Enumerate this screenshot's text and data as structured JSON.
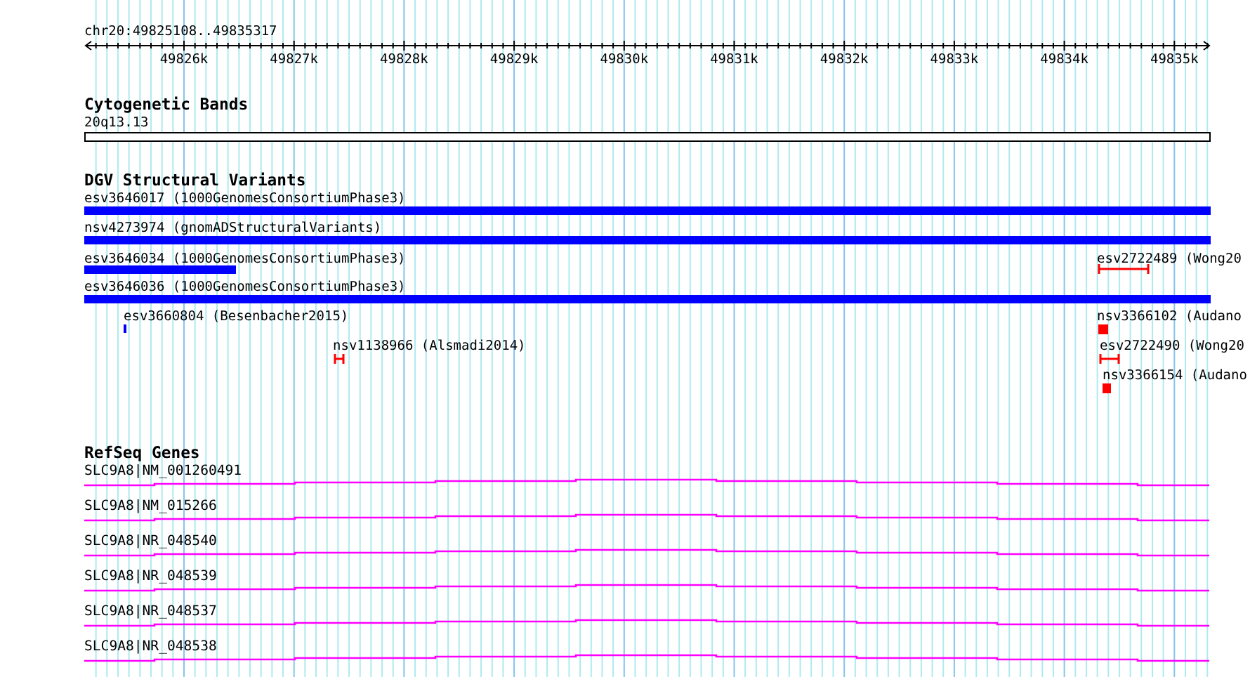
{
  "ruler": {
    "region": "chr20:49825108..49835317",
    "tick_labels": [
      "49826k",
      "49827k",
      "49828k",
      "49829k",
      "49830k",
      "49831k",
      "49832k",
      "49833k",
      "49834k",
      "49835k"
    ]
  },
  "tracks": [
    {
      "kind": "cytoband",
      "title": "Cytogenetic Bands",
      "features": [
        {
          "label": "20q13.13",
          "kind": "band"
        }
      ]
    },
    {
      "kind": "variants",
      "title": "DGV Structural Variants",
      "features": [
        {
          "label": "esv3646017 (1000GenomesConsortiumPhase3)",
          "kind": "bar",
          "color": "#0000ff"
        },
        {
          "label": "nsv4273974 (gnomADStructuralVariants)",
          "kind": "bar",
          "color": "#0000ff"
        },
        {
          "label": "esv3646034 (1000GenomesConsortiumPhase3)",
          "kind": "bar",
          "color": "#0000ff"
        },
        {
          "label": "esv2722489 (Wong20",
          "kind": "range",
          "color": "#ff0000"
        },
        {
          "label": "esv3646036 (1000GenomesConsortiumPhase3)",
          "kind": "bar",
          "color": "#0000ff"
        },
        {
          "label": "esv3660804 (Besenbacher2015)",
          "kind": "bar",
          "color": "#0000ff"
        },
        {
          "label": "nsv3366102 (Audano",
          "kind": "block",
          "color": "#ff0000"
        },
        {
          "label": "nsv1138966 (Alsmadi2014)",
          "kind": "range",
          "color": "#ff0000"
        },
        {
          "label": "esv2722490 (Wong20",
          "kind": "range",
          "color": "#ff0000"
        },
        {
          "label": "nsv3366154 (Audano",
          "kind": "block",
          "color": "#ff0000"
        }
      ]
    },
    {
      "kind": "genes",
      "title": "RefSeq Genes",
      "features": [
        {
          "label": "SLC9A8|NM_001260491",
          "kind": "transcript"
        },
        {
          "label": "SLC9A8|NM_015266",
          "kind": "transcript"
        },
        {
          "label": "SLC9A8|NR_048540",
          "kind": "transcript"
        },
        {
          "label": "SLC9A8|NR_048539",
          "kind": "transcript"
        },
        {
          "label": "SLC9A8|NR_048537",
          "kind": "transcript"
        },
        {
          "label": "SLC9A8|NR_048538",
          "kind": "transcript"
        }
      ]
    }
  ]
}
